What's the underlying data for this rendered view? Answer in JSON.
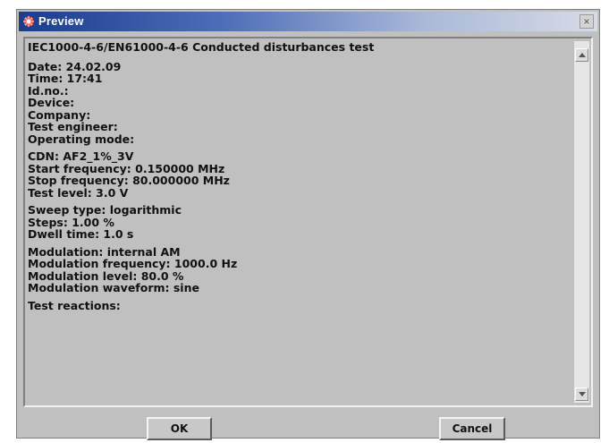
{
  "window": {
    "title": "Preview",
    "close_glyph": "×"
  },
  "report": {
    "header": "IEC1000-4-6/EN61000-4-6 Conducted disturbances test",
    "groups": [
      [
        "Date: 24.02.09",
        "Time: 17:41",
        "Id.no.:",
        "Device:",
        "Company:",
        "Test engineer:",
        "Operating mode:"
      ],
      [
        "CDN: AF2_1%_3V",
        "Start frequency: 0.150000 MHz",
        "Stop frequency: 80.000000 MHz",
        "Test level: 3.0 V"
      ],
      [
        "Sweep type: logarithmic",
        "Steps: 1.00 %",
        "Dwell time: 1.0 s"
      ],
      [
        "Modulation: internal AM",
        "Modulation frequency: 1000.0 Hz",
        "Modulation level: 80.0 %",
        "Modulation waveform: sine"
      ],
      [
        "Test reactions:"
      ]
    ]
  },
  "buttons": {
    "ok": "OK",
    "cancel": "Cancel"
  },
  "icons": {
    "app": "app-icon",
    "close": "close-icon",
    "scroll_up": "arrow-up-icon",
    "scroll_down": "arrow-down-icon"
  }
}
